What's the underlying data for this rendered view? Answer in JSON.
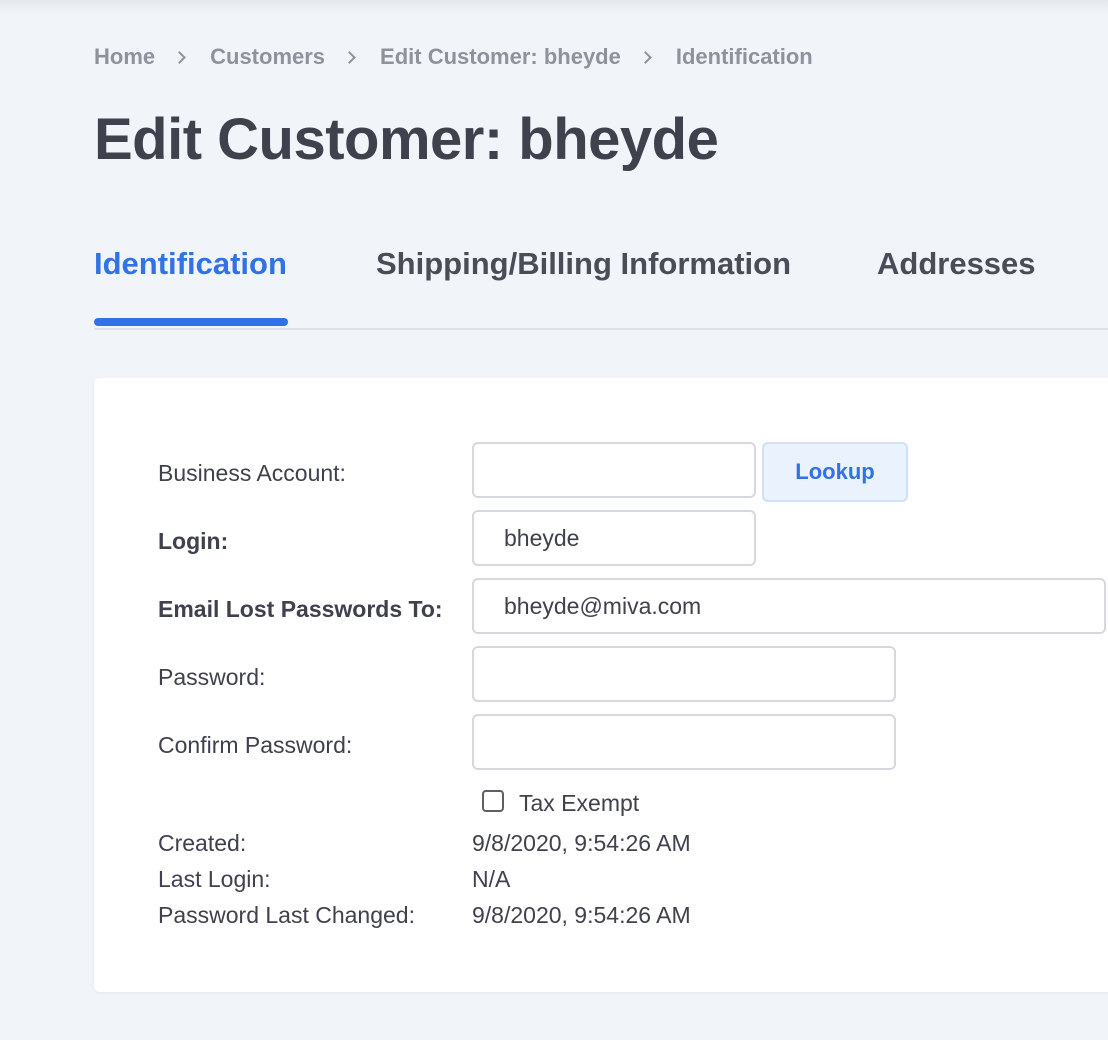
{
  "breadcrumb": [
    "Home",
    "Customers",
    "Edit Customer: bheyde",
    "Identification"
  ],
  "page_title": "Edit Customer: bheyde",
  "tabs": [
    {
      "label": "Identification",
      "active": true
    },
    {
      "label": "Shipping/Billing Information",
      "active": false
    },
    {
      "label": "Addresses",
      "active": false
    }
  ],
  "form": {
    "business_account": {
      "label": "Business Account:",
      "value": ""
    },
    "lookup_label": "Lookup",
    "login": {
      "label": "Login:",
      "value": "bheyde"
    },
    "email_lost_passwords": {
      "label": "Email Lost Passwords To:",
      "value": "bheyde@miva.com"
    },
    "password": {
      "label": "Password:",
      "value": ""
    },
    "confirm_password": {
      "label": "Confirm Password:",
      "value": ""
    },
    "tax_exempt": {
      "label": "Tax Exempt",
      "checked": false
    }
  },
  "info": {
    "created": {
      "label": "Created:",
      "value": "9/8/2020, 9:54:26 AM"
    },
    "last_login": {
      "label": "Last Login:",
      "value": "N/A"
    },
    "password_last_changed": {
      "label": "Password Last Changed:",
      "value": "9/8/2020, 9:54:26 AM"
    }
  },
  "colors": {
    "accent": "#3172e6",
    "background": "#f1f4f8",
    "card": "#ffffff",
    "text": "#3f414c",
    "muted": "#8f929c"
  },
  "icons": {
    "breadcrumb_separator": "chevron-right-icon"
  }
}
